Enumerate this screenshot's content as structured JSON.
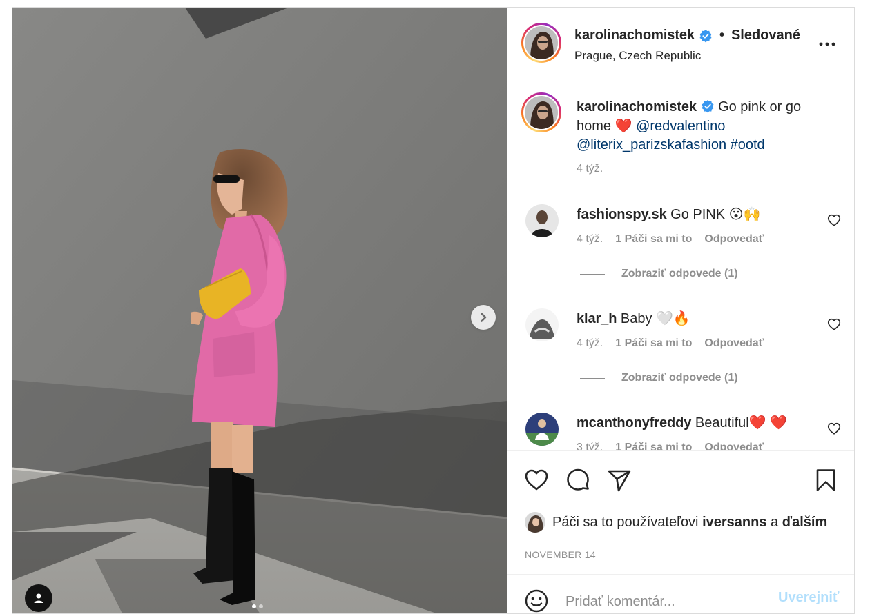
{
  "post": {
    "author": "karolinachomistek",
    "separator": "•",
    "follow_status": "Sledované",
    "location": "Prague, Czech Republic",
    "caption": {
      "text_before": "Go pink or go home",
      "emoji": "❤️",
      "mention_1": "@redvalentino",
      "mention_2": "@literix_parizskafashion",
      "hashtag": "#ootd",
      "time": "4 týž."
    },
    "photo": {
      "next_icon": "chevron-right-icon",
      "user_tag_icon": "user-icon",
      "carousel_count": 2,
      "carousel_active": 0
    }
  },
  "comments": [
    {
      "username": "fashionspy.sk",
      "text": "Go PINK 😮🙌",
      "time": "4 týž.",
      "likes": "1 Páči sa mi to",
      "reply_label": "Odpovedať",
      "view_replies": "Zobraziť odpovede (1)"
    },
    {
      "username": "klar_h",
      "text": "Baby 🤍🔥",
      "time": "4 týž.",
      "likes": "1 Páči sa mi to",
      "reply_label": "Odpovedať",
      "view_replies": "Zobraziť odpovede (1)"
    },
    {
      "username": "mcanthonyfreddy",
      "text": "Beautiful❤️ ❤️",
      "time": "3 týž.",
      "likes": "1 Páči sa mi to",
      "reply_label": "Odpovedať",
      "view_replies": ""
    }
  ],
  "actions": {
    "like_icon": "heart-icon",
    "comment_icon": "comment-icon",
    "share_icon": "send-icon",
    "save_icon": "bookmark-icon",
    "likes_prefix": "Páči sa to používateľovi",
    "likes_user": "iversanns",
    "likes_and": "a",
    "likes_others": "ďalším",
    "date": "NOVEMBER 14"
  },
  "add_comment": {
    "placeholder": "Pridať komentár...",
    "post_label": "Uverejniť",
    "emoji_icon": "smiley-icon"
  },
  "colors": {
    "link": "#00376b",
    "muted": "#8e8e8e",
    "verified": "#3897f0",
    "coat": "#e16aa7",
    "bag": "#e8b425",
    "wall": "#7d7d7b",
    "post_button_disabled": "#b2dffc"
  }
}
